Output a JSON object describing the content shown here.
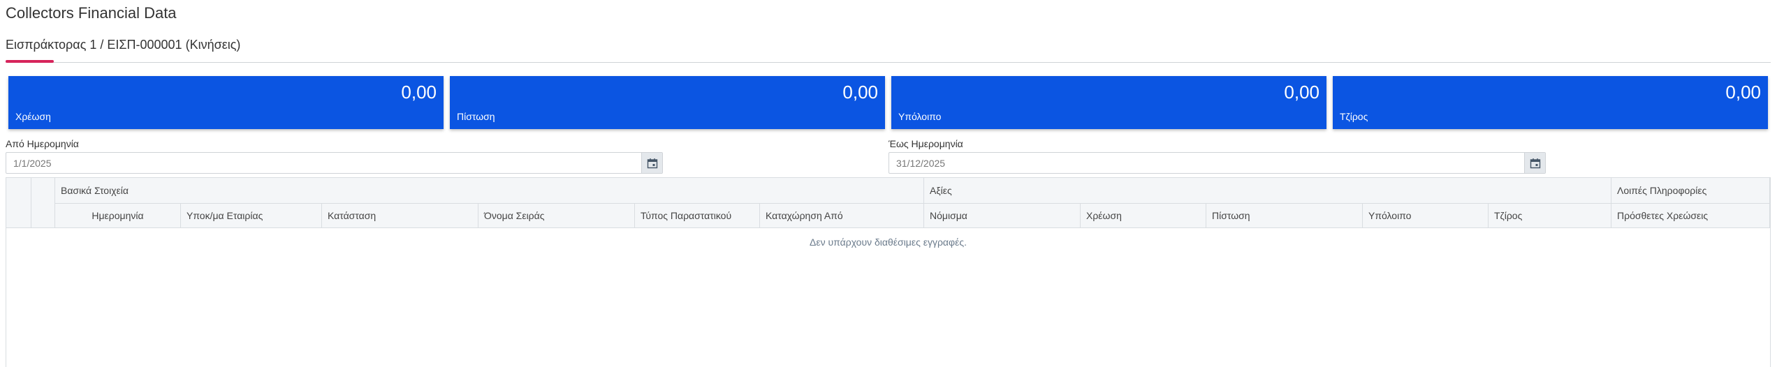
{
  "page": {
    "title": "Collectors Financial Data"
  },
  "tabs": [
    {
      "label": "Εισπράκτορας 1 / ΕΙΣΠ-000001 (Κινήσεις)",
      "active": true
    }
  ],
  "colors": {
    "card_bg": "#0b55e2",
    "tab_accent": "#d6245b",
    "header_bg": "#f4f6f8"
  },
  "summary_cards": [
    {
      "label": "Χρέωση",
      "value": "0,00"
    },
    {
      "label": "Πίστωση",
      "value": "0,00"
    },
    {
      "label": "Υπόλοιπο",
      "value": "0,00"
    },
    {
      "label": "Τζίρος",
      "value": "0,00"
    }
  ],
  "filters": {
    "from_date": {
      "label": "Από Ημερομηνία",
      "value": "1/1/2025",
      "icon": "calendar-icon"
    },
    "to_date": {
      "label": "Έως Ημερομηνία",
      "value": "31/12/2025",
      "icon": "calendar-icon"
    }
  },
  "grid": {
    "groups": [
      "Βασικά Στοιχεία",
      "Αξίες",
      "Λοιπές Πληροφορίες"
    ],
    "columns": [
      "Ημερομηνία",
      "Υποκ/μα Εταιρίας",
      "Κατάσταση",
      "Όνομα Σειράς",
      "Τύπος Παραστατικού",
      "Καταχώρηση Από",
      "Νόμισμα",
      "Χρέωση",
      "Πίστωση",
      "Υπόλοιπο",
      "Τζίρος",
      "Πρόσθετες Χρεώσεις"
    ],
    "empty_message": "Δεν υπάρχουν διαθέσιμες εγγραφές."
  }
}
